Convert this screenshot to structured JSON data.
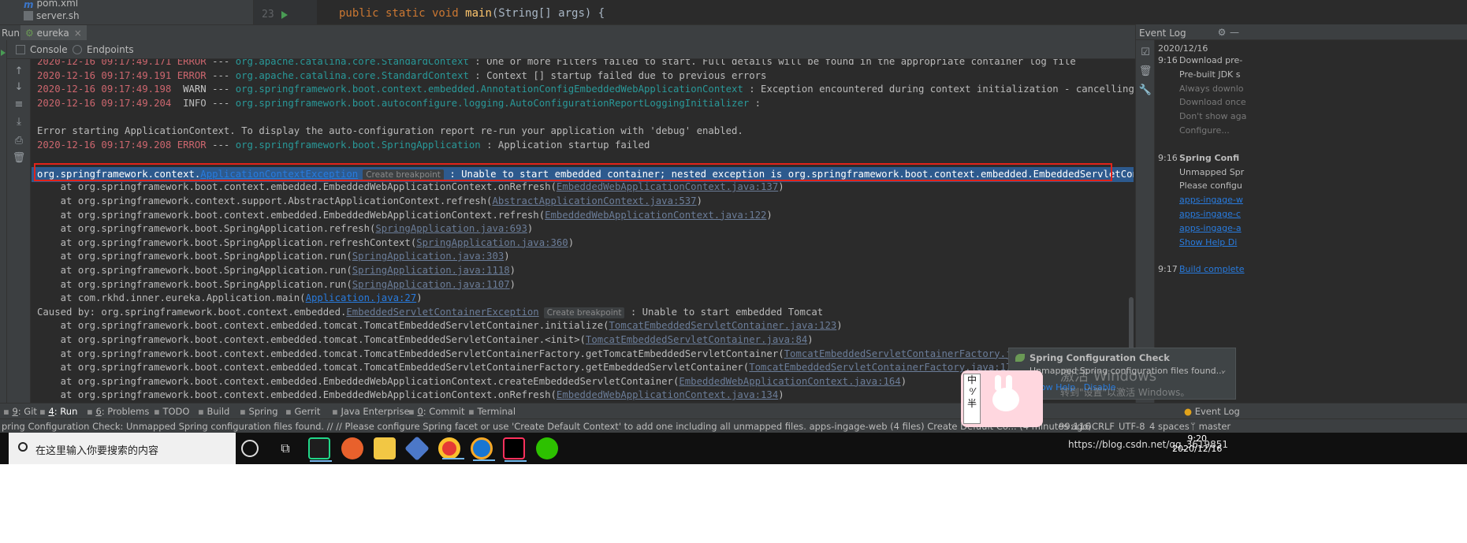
{
  "project_tree": {
    "items": [
      {
        "label": "pom.xml",
        "icon": "maven-icon"
      },
      {
        "label": "server.sh",
        "icon": "file-icon"
      }
    ]
  },
  "editor": {
    "line_number": "23",
    "code": "public static void main(String[] args) {"
  },
  "run_window": {
    "label": "Run:",
    "tab_label": "eureka",
    "console_tab": "Console",
    "endpoints_tab": "Endpoints"
  },
  "console": {
    "lines": [
      {
        "ts": "2020-12-16 09:17:49.171",
        "level": "ERROR",
        "logger": "org.apache.catalina.core.StandardContext",
        "msg": " : One or more Filters failed to start. Full details will be found in the appropriate container log file"
      },
      {
        "ts": "2020-12-16 09:17:49.191",
        "level": "ERROR",
        "logger": "org.apache.catalina.core.StandardContext",
        "msg": " : Context [] startup failed due to previous errors"
      },
      {
        "ts": "2020-12-16 09:17:49.198",
        "level": " WARN",
        "logger": "org.springframework.boot.context.embedded.AnnotationConfigEmbeddedWebApplicationContext",
        "msg": " : Exception encountered during context initialization - cancelling refresh attempt: o"
      },
      {
        "ts": "2020-12-16 09:17:49.204",
        "level": " INFO",
        "logger": "org.springframework.boot.autoconfigure.logging.AutoConfigurationReportLoggingInitializer",
        "msg": " :"
      },
      {
        "plain": ""
      },
      {
        "plain": "Error starting ApplicationContext. To display the auto-configuration report re-run your application with 'debug' enabled."
      },
      {
        "ts": "2020-12-16 09:17:49.208",
        "level": "ERROR",
        "logger": "org.springframework.boot.SpringApplication",
        "msg": " : Application startup failed"
      }
    ],
    "exception": {
      "prefix": "org.springframework.context.",
      "class_link": "ApplicationContextException",
      "breakpoint": "Create breakpoint",
      "message": " : Unable to start embedded container; nested exception is org.springframework.boot.context.embedded.EmbeddedServletContainerException: Un"
    },
    "stack1": [
      {
        "at": "    at org.springframework.boot.context.embedded.EmbeddedWebApplicationContext.onRefresh(",
        "src": "EmbeddedWebApplicationContext.java:137",
        "end": ")"
      },
      {
        "at": "    at org.springframework.context.support.AbstractApplicationContext.refresh(",
        "src": "AbstractApplicationContext.java:537",
        "end": ")"
      },
      {
        "at": "    at org.springframework.boot.context.embedded.EmbeddedWebApplicationContext.refresh(",
        "src": "EmbeddedWebApplicationContext.java:122",
        "end": ")"
      },
      {
        "at": "    at org.springframework.boot.SpringApplication.refresh(",
        "src": "SpringApplication.java:693",
        "end": ")"
      },
      {
        "at": "    at org.springframework.boot.SpringApplication.refreshContext(",
        "src": "SpringApplication.java:360",
        "end": ")"
      },
      {
        "at": "    at org.springframework.boot.SpringApplication.run(",
        "src": "SpringApplication.java:303",
        "end": ")"
      },
      {
        "at": "    at org.springframework.boot.SpringApplication.run(",
        "src": "SpringApplication.java:1118",
        "end": ")"
      },
      {
        "at": "    at org.springframework.boot.SpringApplication.run(",
        "src": "SpringApplication.java:1107",
        "end": ")"
      },
      {
        "at": "    at com.rkhd.inner.eureka.Application.main(",
        "src": "Application.java:27",
        "end": ")",
        "bright": true
      }
    ],
    "caused_by": {
      "prefix": "Caused by: org.springframework.boot.context.embedded.",
      "class_link": "EmbeddedServletContainerException",
      "breakpoint": "Create breakpoint",
      "message": " : Unable to start embedded Tomcat"
    },
    "stack2": [
      {
        "at": "    at org.springframework.boot.context.embedded.tomcat.TomcatEmbeddedServletContainer.initialize(",
        "src": "TomcatEmbeddedServletContainer.java:123",
        "end": ")"
      },
      {
        "at": "    at org.springframework.boot.context.embedded.tomcat.TomcatEmbeddedServletContainer.<init>(",
        "src": "TomcatEmbeddedServletContainer.java:84",
        "end": ")"
      },
      {
        "at": "    at org.springframework.boot.context.embedded.tomcat.TomcatEmbeddedServletContainerFactory.getTomcatEmbeddedServletContainer(",
        "src": "TomcatEmbeddedServletContainerFactory.java:554",
        "end": ")"
      },
      {
        "at": "    at org.springframework.boot.context.embedded.tomcat.TomcatEmbeddedServletContainerFactory.getEmbeddedServletContainer(",
        "src": "TomcatEmbeddedServletContainerFactory.java:179",
        "end": ")"
      },
      {
        "at": "    at org.springframework.boot.context.embedded.EmbeddedWebApplicationContext.createEmbeddedServletContainer(",
        "src": "EmbeddedWebApplicationContext.java:164",
        "end": ")"
      },
      {
        "at": "    at org.springframework.boot.context.embedded.EmbeddedWebApplicationContext.onRefresh(",
        "src": "EmbeddedWebApplicationContext.java:134",
        "end": ")"
      }
    ]
  },
  "event_log": {
    "title": "Event Log",
    "date": "2020/12/16",
    "entries": [
      {
        "time": "9:16",
        "lines": [
          {
            "text": "Download pre-",
            "style": "text"
          },
          {
            "text": "Pre-built JDK s",
            "style": "text"
          },
          {
            "text": "Always downlo",
            "style": "dim"
          },
          {
            "text": "Download once",
            "style": "dim"
          },
          {
            "text": "Don't show aga",
            "style": "dim"
          },
          {
            "text": "Configure...",
            "style": "dim"
          }
        ]
      },
      {
        "time": "9:16",
        "lines": [
          {
            "text": "Spring Confi",
            "style": "bold"
          },
          {
            "text": "Unmapped Spr",
            "style": "text"
          },
          {
            "text": "Please configu",
            "style": "text"
          },
          {
            "text": "apps-ingage-w",
            "style": "link"
          },
          {
            "text": "apps-ingage-c",
            "style": "link"
          },
          {
            "text": "apps-ingage-a",
            "style": "link"
          },
          {
            "text": "Show Help   Di",
            "style": "link"
          }
        ]
      },
      {
        "time": "9:17",
        "lines": [
          {
            "text": "Build complete",
            "style": "link"
          }
        ]
      }
    ]
  },
  "balloon": {
    "title": "Spring Configuration Check",
    "text": "Unmapped Spring configuration files found...",
    "show_help": "Show Help",
    "disable": "Disable",
    "watermark": "激活 Windows",
    "watermark_sub": "转到\"设置\"以激活 Windows。"
  },
  "tool_tabs": [
    {
      "num": "9",
      "label": ": Git"
    },
    {
      "num": "4",
      "label": ": Run",
      "active": true
    },
    {
      "num": "6",
      "label": ": Problems"
    },
    {
      "num": "",
      "label": "TODO"
    },
    {
      "num": "",
      "label": "Build"
    },
    {
      "num": "",
      "label": "Spring"
    },
    {
      "num": "",
      "label": "Gerrit"
    },
    {
      "num": "",
      "label": "Java Enterprise"
    },
    {
      "num": "0",
      "label": ": Commit"
    },
    {
      "num": "",
      "label": "Terminal"
    }
  ],
  "event_log_tab": "Event Log",
  "status": {
    "message": "pring Configuration Check: Unmapped Spring configuration files found. // // Please configure Spring facet or use 'Create Default Context' to add one including all unmapped files. apps-ingage-web (4 files)   Create Default Co... (4 minutes ago)",
    "position": "99:116",
    "line_sep": "CRLF",
    "encoding": "UTF-8",
    "indent": "4 spaces",
    "branch": "master"
  },
  "ime": {
    "lines": [
      "中",
      "⁰⁄",
      "半"
    ]
  },
  "taskbar": {
    "search_placeholder": "在这里输入你要搜索的内容",
    "tray_text": "https://blog.csdn.net/qq_3619851",
    "time": "9:20",
    "date": "2020/12/16"
  }
}
